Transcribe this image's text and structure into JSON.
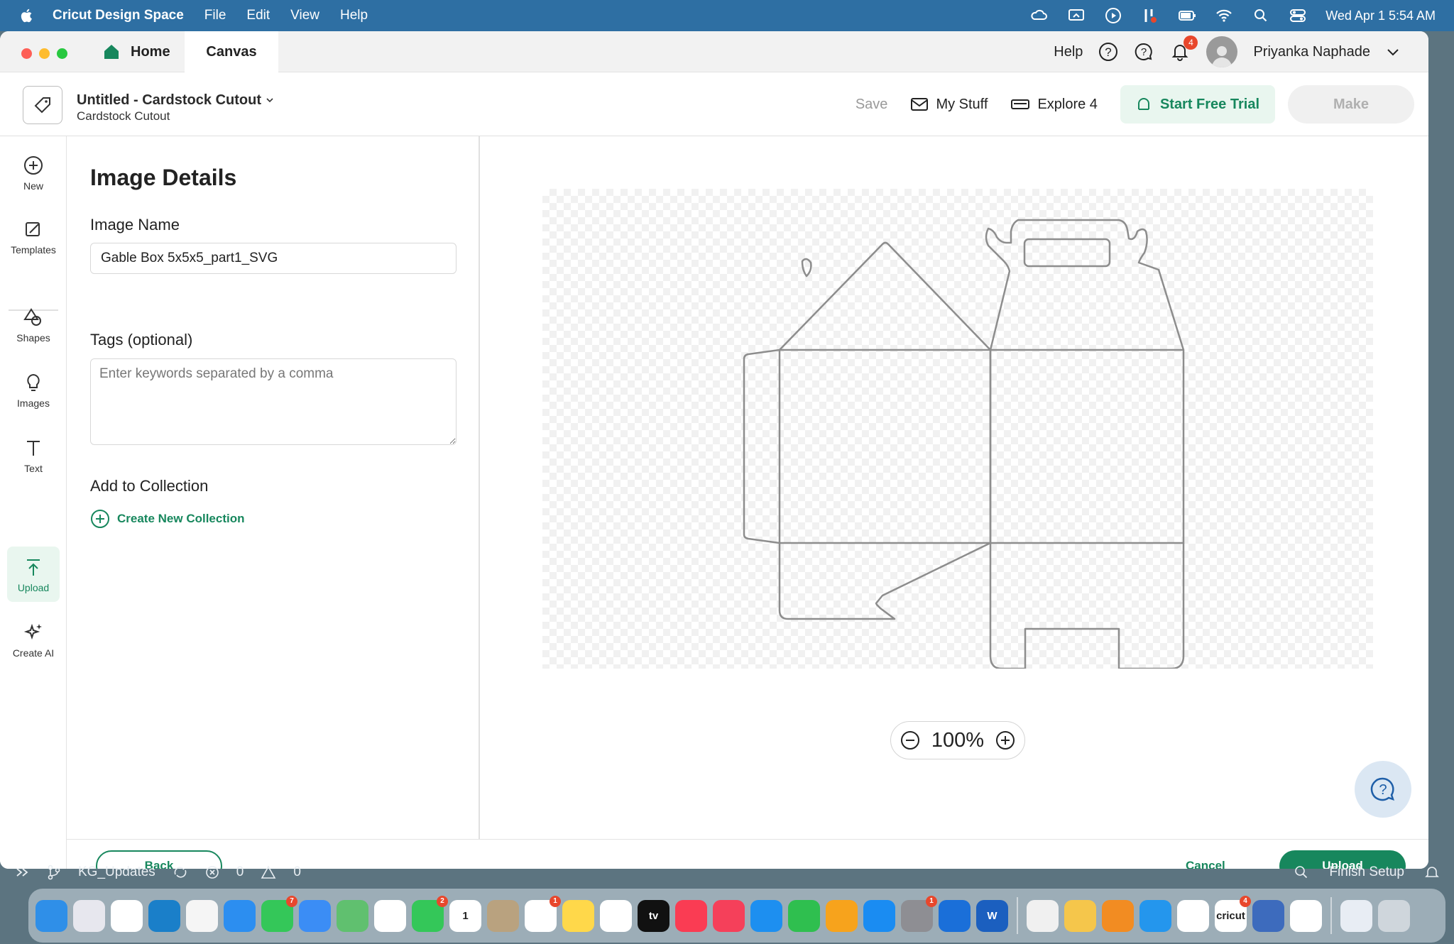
{
  "menubar": {
    "app_name": "Cricut Design Space",
    "items": [
      "File",
      "Edit",
      "View",
      "Help"
    ],
    "clock": "Wed Apr 1  5:54 AM"
  },
  "titlebar": {
    "tabs": [
      {
        "label": "Home"
      },
      {
        "label": "Canvas"
      }
    ],
    "help_label": "Help",
    "notification_count": "4",
    "user_name": "Priyanka Naphade"
  },
  "header": {
    "project_title": "Untitled - Cardstock Cutout",
    "project_subtitle": "Cardstock Cutout",
    "save_label": "Save",
    "my_stuff_label": "My Stuff",
    "explore_label": "Explore 4",
    "trial_label": "Start Free Trial",
    "make_label": "Make"
  },
  "left_tools": [
    {
      "label": "New",
      "icon": "plus-circle-icon"
    },
    {
      "label": "Templates",
      "icon": "templates-icon"
    },
    {
      "label": "Shapes",
      "icon": "shapes-icon"
    },
    {
      "label": "Images",
      "icon": "lightbulb-icon"
    },
    {
      "label": "Text",
      "icon": "text-icon"
    },
    {
      "label": "Upload",
      "icon": "upload-icon"
    },
    {
      "label": "Create AI",
      "icon": "sparkle-icon"
    }
  ],
  "details": {
    "title": "Image Details",
    "image_name_label": "Image Name",
    "image_name_value": "Gable Box 5x5x5_part1_SVG",
    "tags_label": "Tags (optional)",
    "tags_placeholder": "Enter keywords separated by a comma",
    "collection_label": "Add to Collection",
    "create_collection_label": "Create New Collection"
  },
  "canvas": {
    "zoom": "100%"
  },
  "footer": {
    "back_label": "Back",
    "cancel_label": "Cancel",
    "upload_label": "Upload"
  },
  "status_strip": {
    "branch": "KG_Updates",
    "errors": "0",
    "warnings": "0",
    "finish_setup": "Finish Setup"
  },
  "dock": {
    "apps": [
      {
        "name": "Finder",
        "color": "#2f8fe8"
      },
      {
        "name": "Launchpad",
        "color": "#e7e7ee"
      },
      {
        "name": "Chrome",
        "color": "#ffffff"
      },
      {
        "name": "Edge",
        "color": "#1a7fc9"
      },
      {
        "name": "Maps Alt",
        "color": "#f5f5f5"
      },
      {
        "name": "Safari",
        "color": "#2c8ef0"
      },
      {
        "name": "Messages",
        "color": "#34c759",
        "badge": "7"
      },
      {
        "name": "Mail",
        "color": "#3b8df5"
      },
      {
        "name": "Maps",
        "color": "#60c06f"
      },
      {
        "name": "Photos",
        "color": "#ffffff"
      },
      {
        "name": "FaceTime",
        "color": "#34c759",
        "badge": "2"
      },
      {
        "name": "Calendar",
        "color": "#ffffff",
        "text": "1"
      },
      {
        "name": "Contacts",
        "color": "#b9a27f"
      },
      {
        "name": "Reminders",
        "color": "#ffffff",
        "badge": "1"
      },
      {
        "name": "Notes",
        "color": "#ffd84a"
      },
      {
        "name": "Freeform",
        "color": "#ffffff"
      },
      {
        "name": "TV",
        "color": "#111111",
        "text": "tv"
      },
      {
        "name": "Music",
        "color": "#fa3c53"
      },
      {
        "name": "News",
        "color": "#f5405a"
      },
      {
        "name": "Keynote",
        "color": "#1d8ff0"
      },
      {
        "name": "Numbers",
        "color": "#2fbf4f"
      },
      {
        "name": "Pages",
        "color": "#f7a31c"
      },
      {
        "name": "App Store",
        "color": "#1a8cf2"
      },
      {
        "name": "System Settings",
        "color": "#8e8e93",
        "badge": "1"
      },
      {
        "name": "Windows App",
        "color": "#1a6fd9"
      },
      {
        "name": "Word",
        "color": "#1b5fbf",
        "text": "W"
      },
      {
        "name": "MongoDB Compass",
        "color": "#f0f0f0"
      },
      {
        "name": "Amphetamine",
        "color": "#f5c64b"
      },
      {
        "name": "Books",
        "color": "#f28c22"
      },
      {
        "name": "Docker",
        "color": "#2496ed"
      },
      {
        "name": "VS Code",
        "color": "#ffffff"
      },
      {
        "name": "Cricut",
        "color": "#ffffff",
        "text": "cricut",
        "badge": "4"
      },
      {
        "name": "Copilot Bot",
        "color": "#3d6bbd"
      },
      {
        "name": "YouTube",
        "color": "#ffffff"
      },
      {
        "name": "Downloads",
        "color": "#e8edf4"
      },
      {
        "name": "Trash",
        "color": "#cfd6dc"
      }
    ]
  },
  "colors": {
    "accent_green": "#17875d",
    "menubar_blue": "#2e6fa3"
  }
}
